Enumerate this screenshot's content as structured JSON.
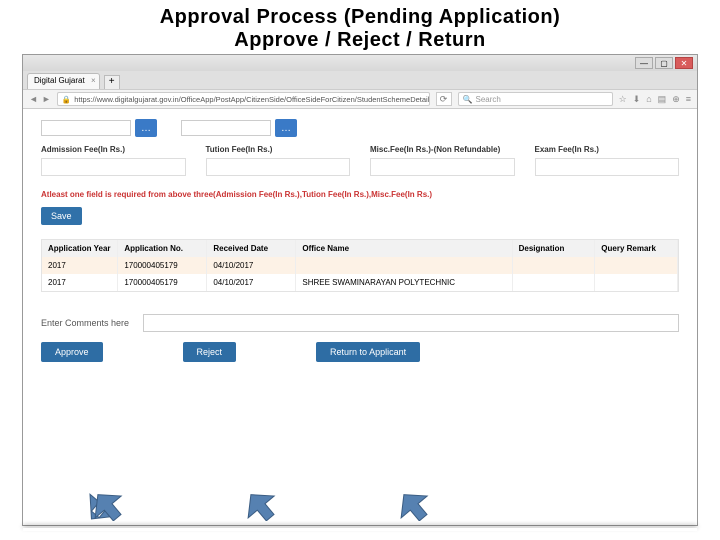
{
  "slide": {
    "title_line1": "Approval Process (Pending Application)",
    "title_line2": "Approve / Reject / Return"
  },
  "browser": {
    "tab_title": "Digital Gujarat",
    "url": "https://www.digitalgujarat.gov.in/OfficeApp/PostApp/CitizenSide/OfficeSideForCitizen/StudentSchemeDetailEntry_SC.asp",
    "search_placeholder": "Search",
    "win_min": "—",
    "win_max": "▢",
    "win_close": "✕",
    "tab_close": "×",
    "tab_add": "+",
    "back": "◄",
    "fwd": "►",
    "refresh": "⟳",
    "search_icon": "🔍",
    "star": "☆",
    "download": "⬇",
    "home": "⌂",
    "bookmark": "▤",
    "usb": "⊕",
    "menu": "≡"
  },
  "form": {
    "lookup": "…",
    "admission_label": "Admission Fee(In Rs.)",
    "tuition_label": "Tution Fee(In Rs.)",
    "misc_label": "Misc.Fee(In Rs.)-(Non Refundable)",
    "exam_label": "Exam Fee(In Rs.)",
    "warning": "Atleast one field is required from above three(Admission Fee(In Rs.),Tution Fee(In Rs.),Misc.Fee(In Rs.)",
    "save": "Save"
  },
  "table": {
    "headers": {
      "c1": "Application Year",
      "c2": "Application No.",
      "c3": "Received Date",
      "c4": "Office Name",
      "c5": "Designation",
      "c6": "Query Remark"
    },
    "rows": [
      {
        "c1": "2017",
        "c2": "170000405179",
        "c3": "04/10/2017",
        "c4": "",
        "c5": "",
        "c6": ""
      },
      {
        "c1": "2017",
        "c2": "170000405179",
        "c3": "04/10/2017",
        "c4": "SHREE SWAMINARAYAN POLYTECHNIC",
        "c5": "",
        "c6": ""
      }
    ]
  },
  "comments": {
    "label": "Enter Comments here"
  },
  "actions": {
    "approve": "Approve",
    "reject": "Reject",
    "return": "Return to Applicant"
  }
}
